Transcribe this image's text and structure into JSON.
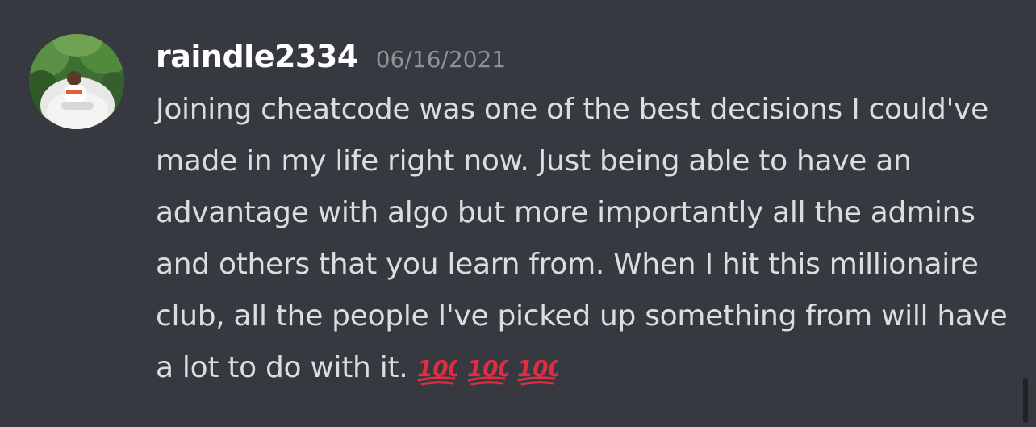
{
  "message": {
    "username": "raindle2334",
    "timestamp": "06/16/2021",
    "text": "Joining cheatcode was one of the best decisions I could've made in my life right now. Just being able to have an advantage with algo but more importantly all the admins and others that you learn from. When I hit this millionaire club, all the people I've picked up something from will have a lot to do with it.",
    "emojis": [
      "hundred-points-icon",
      "hundred-points-icon",
      "hundred-points-icon"
    ]
  },
  "colors": {
    "background": "#36393f",
    "username": "#ffffff",
    "timestamp": "#8e9297",
    "text": "#dcddde",
    "emoji_red": "#dd2e44"
  }
}
